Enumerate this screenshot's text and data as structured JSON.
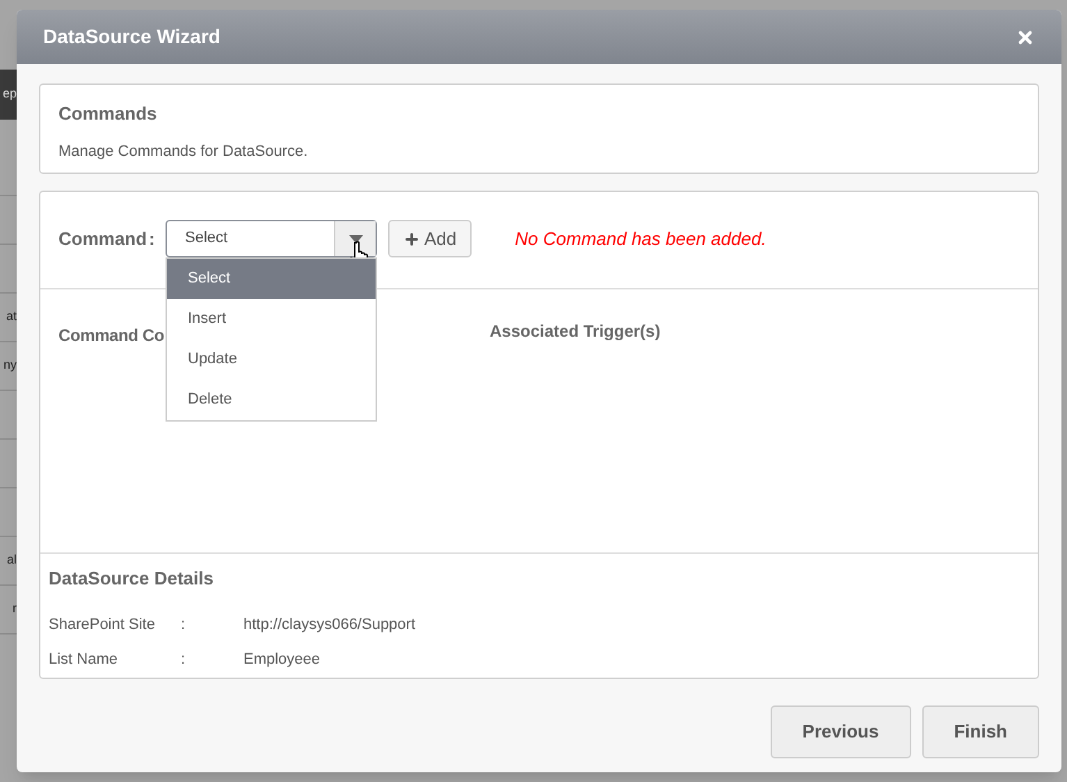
{
  "background": {
    "bar_text": "ep",
    "cells": [
      {},
      {},
      {},
      {
        "text": "at"
      },
      {
        "text": "ny"
      },
      {},
      {},
      {},
      {
        "text": "al"
      },
      {
        "text": "r"
      }
    ]
  },
  "window": {
    "title": "DataSource Wizard"
  },
  "commands_card": {
    "title": "Commands",
    "description": "Manage Commands for DataSource."
  },
  "command_row": {
    "label": "Command",
    "separator": ":",
    "select": {
      "value": "Select",
      "expanded": true,
      "options": [
        {
          "label": "Select",
          "selected": true
        },
        {
          "label": "Insert",
          "selected": false
        },
        {
          "label": "Update",
          "selected": false
        },
        {
          "label": "Delete",
          "selected": false
        }
      ]
    },
    "add_button": "Add",
    "message": "No Command has been added."
  },
  "columns": [
    "Command Co",
    "Associated Trigger(s)"
  ],
  "details": {
    "title": "DataSource Details",
    "rows": [
      {
        "label": "SharePoint Site",
        "separator": ":",
        "value": "http://claysys066/Support"
      },
      {
        "label": "List Name",
        "separator": ":",
        "value": "Employeee"
      }
    ]
  },
  "buttons": [
    "Previous",
    "Finish"
  ]
}
